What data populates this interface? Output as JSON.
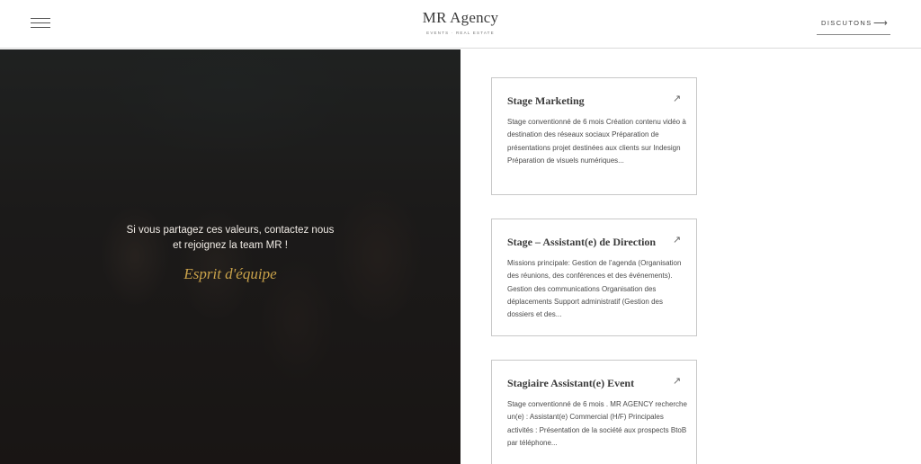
{
  "header": {
    "menu_icon": "hamburger-menu-icon",
    "brand_name": "MR Agency",
    "brand_tagline": "EVENTS · REAL ESTATE",
    "cta_label": "DISCUTONS",
    "cta_arrow": "⟶"
  },
  "hero": {
    "text": "Si vous partagez ces valeurs, contactez nous et rejoignez la team MR !",
    "accent": "Esprit d'équipe"
  },
  "jobs": [
    {
      "title": "Stage Marketing",
      "arrow": "↗",
      "description": "Stage conventionné de 6 mois Création contenu vidéo à destination des réseaux sociaux Préparation de présentations projet destinées aux clients sur Indesign Préparation de visuels numériques..."
    },
    {
      "title": "Stage – Assistant(e) de Direction",
      "arrow": "↗",
      "description": "Missions principale: Gestion de l’agenda  (Organisation des réunions, des conférences et des événements). Gestion des communications Organisation des déplacements Support administratif (Gestion des dossiers et des..."
    },
    {
      "title": "Stagiaire Assistant(e) Event",
      "arrow": "↗",
      "description": "Stage conventionné de 6 mois . MR AGENCY recherche un(e) : Assistant(e) Commercial (H/F) Principales activités : Présentation de la société aux prospects BtoB par téléphone..."
    }
  ],
  "colors": {
    "accent": "#c9a24a",
    "border": "#c8c8c8",
    "hero_text": "#f1ece6"
  }
}
